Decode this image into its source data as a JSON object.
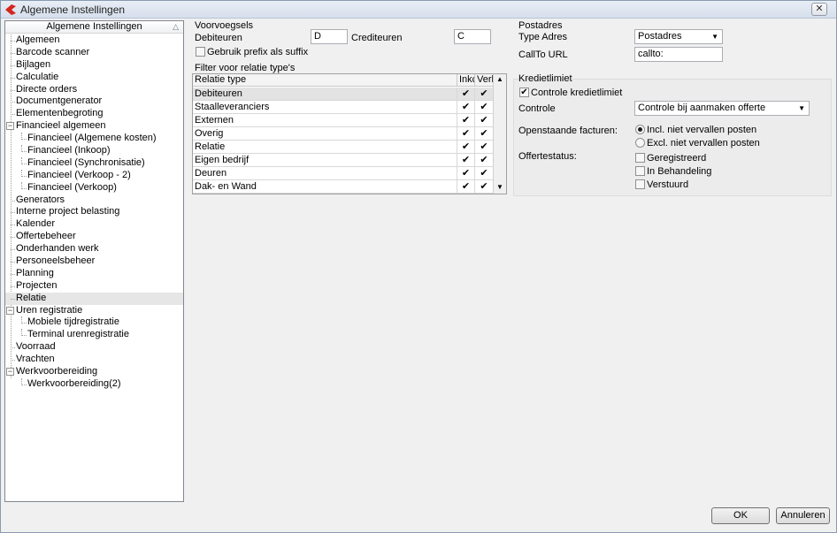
{
  "window": {
    "title": "Algemene Instellingen",
    "close_glyph": "✕",
    "brand_color": "#d4261e"
  },
  "tree": {
    "header": "Algemene Instellingen",
    "sort_glyph": "△",
    "items": [
      {
        "label": "Algemeen",
        "level": 0
      },
      {
        "label": "Barcode scanner",
        "level": 0
      },
      {
        "label": "Bijlagen",
        "level": 0
      },
      {
        "label": "Calculatie",
        "level": 0
      },
      {
        "label": "Directe orders",
        "level": 0
      },
      {
        "label": "Documentgenerator",
        "level": 0
      },
      {
        "label": "Elementenbegroting",
        "level": 0
      },
      {
        "label": "Financieel algemeen",
        "level": 0,
        "expander": "−"
      },
      {
        "label": "Financieel (Algemene kosten)",
        "level": 1
      },
      {
        "label": "Financieel (Inkoop)",
        "level": 1
      },
      {
        "label": "Financieel (Synchronisatie)",
        "level": 1
      },
      {
        "label": "Financieel (Verkoop - 2)",
        "level": 1
      },
      {
        "label": "Financieel (Verkoop)",
        "level": 1
      },
      {
        "label": "Generators",
        "level": 0
      },
      {
        "label": "Interne project belasting",
        "level": 0
      },
      {
        "label": "Kalender",
        "level": 0
      },
      {
        "label": "Offertebeheer",
        "level": 0
      },
      {
        "label": "Onderhanden werk",
        "level": 0
      },
      {
        "label": "Personeelsbeheer",
        "level": 0
      },
      {
        "label": "Planning",
        "level": 0
      },
      {
        "label": "Projecten",
        "level": 0
      },
      {
        "label": "Relatie",
        "level": 0,
        "selected": true
      },
      {
        "label": "Uren registratie",
        "level": 0,
        "expander": "−"
      },
      {
        "label": "Mobiele tijdregistratie",
        "level": 1
      },
      {
        "label": "Terminal urenregistratie",
        "level": 1
      },
      {
        "label": "Voorraad",
        "level": 0
      },
      {
        "label": "Vrachten",
        "level": 0
      },
      {
        "label": "Werkvoorbereiding",
        "level": 0,
        "expander": "−"
      },
      {
        "label": "Werkvoorbereiding(2)",
        "level": 1
      }
    ]
  },
  "voorvoegsels": {
    "title": "Voorvoegsels",
    "debiteuren_label": "Debiteuren",
    "debiteuren_value": "D",
    "crediteuren_label": "Crediteuren",
    "crediteuren_value": "C",
    "suffix_label": "Gebruik prefix als suffix",
    "suffix_checked": false
  },
  "filter": {
    "title": "Filter voor relatie type's",
    "columns": [
      "Relatie type",
      "Inkc",
      "Verk"
    ],
    "rows": [
      {
        "type": "Debiteuren",
        "inkoop": "✔",
        "verkoop": "✔"
      },
      {
        "type": "Staalleveranciers",
        "inkoop": "✔",
        "verkoop": "✔"
      },
      {
        "type": "Externen",
        "inkoop": "✔",
        "verkoop": "✔"
      },
      {
        "type": "Overig",
        "inkoop": "✔",
        "verkoop": "✔"
      },
      {
        "type": "Relatie",
        "inkoop": "✔",
        "verkoop": "✔"
      },
      {
        "type": "Eigen bedrijf",
        "inkoop": "✔",
        "verkoop": "✔"
      },
      {
        "type": "Deuren",
        "inkoop": "✔",
        "verkoop": "✔"
      },
      {
        "type": "Dak- en Wand",
        "inkoop": "✔",
        "verkoop": "✔"
      }
    ],
    "scroll_up": "▲",
    "scroll_down": "▼"
  },
  "postadres": {
    "title": "Postadres",
    "type_label": "Type Adres",
    "type_value": "Postadres",
    "callto_label": "CallTo URL",
    "callto_value": "callto:"
  },
  "kredietlimiet": {
    "title": "Kredietlimiet",
    "controle_check_label": "Controle kredietlimiet",
    "controle_checked": true,
    "controle_label": "Controle",
    "controle_value": "Controle bij aanmaken offerte",
    "facturen_label": "Openstaande facturen:",
    "radio_incl": "Incl. niet vervallen posten",
    "radio_excl": "Excl. niet vervallen posten",
    "offerte_label": "Offertestatus:",
    "status_options": [
      "Geregistreerd",
      "In Behandeling",
      "Verstuurd"
    ]
  },
  "buttons": {
    "ok": "OK",
    "cancel": "Annuleren"
  },
  "glyphs": {
    "check": "✔",
    "dropdown": "▼"
  }
}
